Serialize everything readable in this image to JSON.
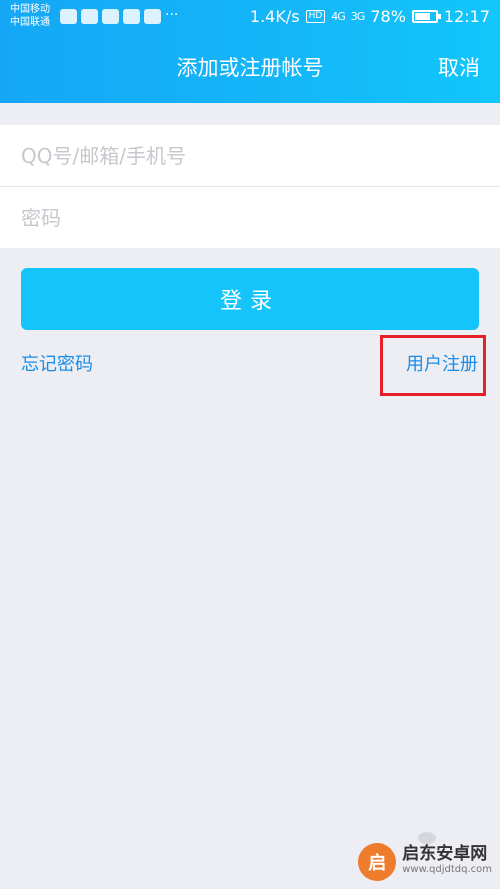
{
  "status_bar": {
    "carrier_1": "中国移动",
    "carrier_2": "中国联通",
    "overflow": "···",
    "net_speed": "1.4K/s",
    "hd_badge": "HD",
    "signal_1": "4G",
    "signal_2": "3G",
    "battery_percent": "78%",
    "time": "12:17"
  },
  "nav": {
    "title": "添加或注册帐号",
    "cancel_label": "取消"
  },
  "form": {
    "account_placeholder": "QQ号/邮箱/手机号",
    "password_placeholder": "密码"
  },
  "login_label": "登录",
  "links": {
    "forgot_password": "忘记密码",
    "register": "用户注册"
  },
  "watermark": {
    "logo": "启",
    "name": "启东安卓网",
    "url": "www.qdjdtdq.com"
  },
  "colors": {
    "header_start": "#15a7f6",
    "header_end": "#12c6fb",
    "login_button": "#14c4fa",
    "link": "#1a8ce6",
    "highlight": "#e6202a"
  }
}
